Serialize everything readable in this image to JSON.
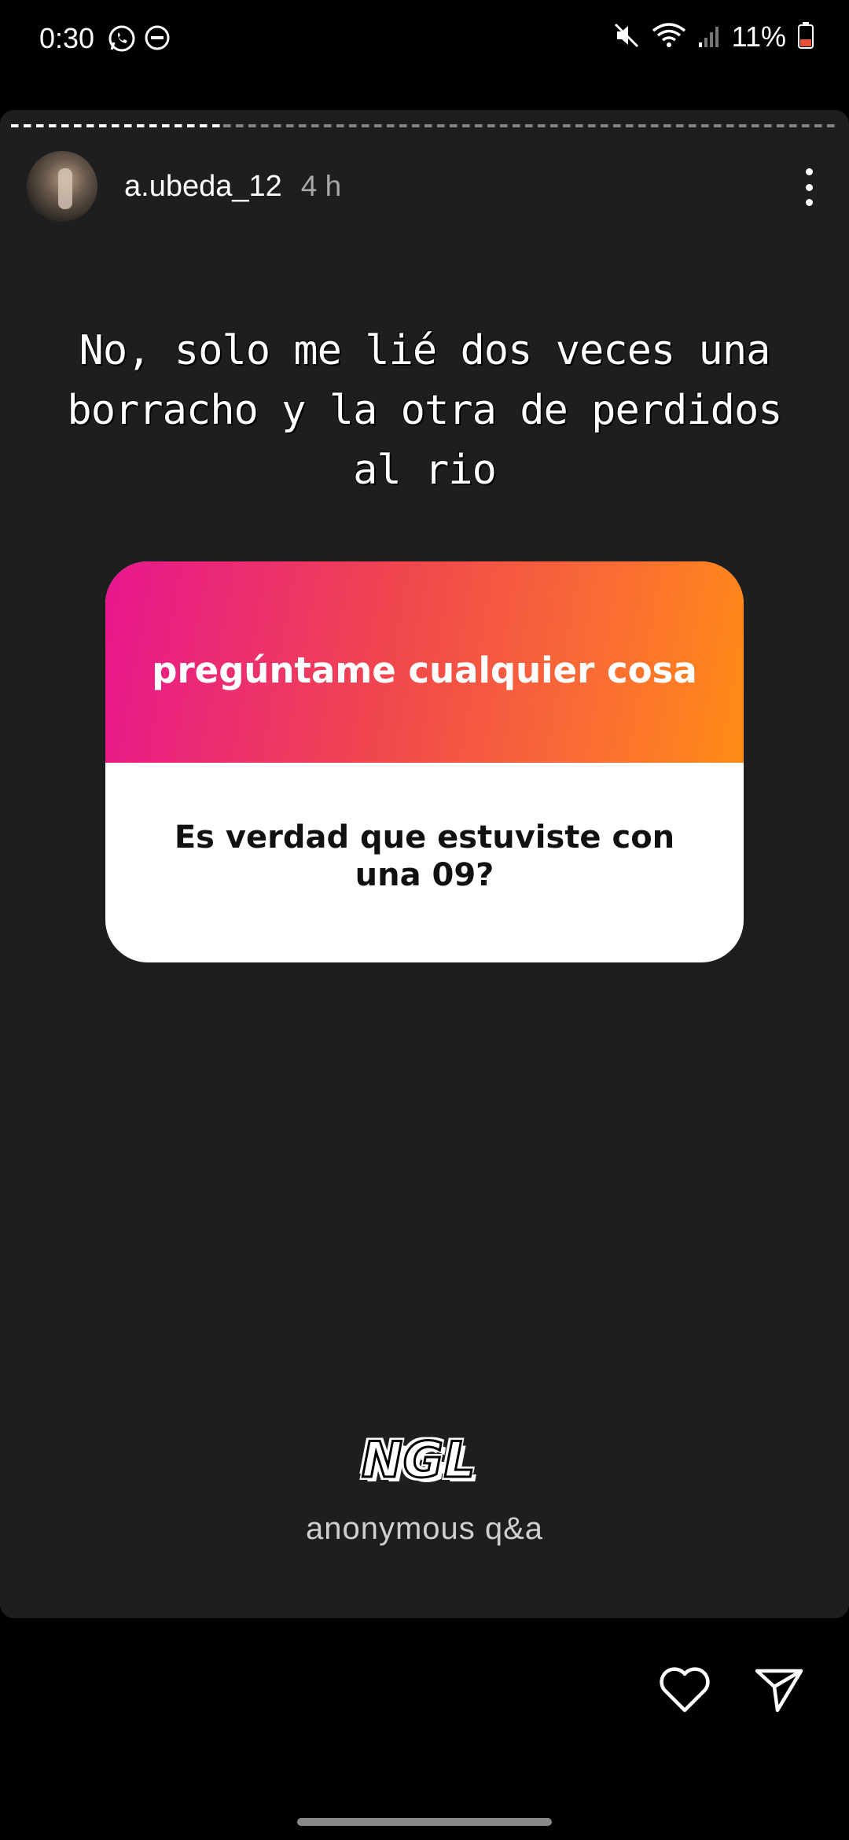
{
  "status_bar": {
    "time": "0:30",
    "battery": "11%",
    "icons": [
      "whatsapp-icon",
      "dnd-icon",
      "mute-icon",
      "wifi-icon",
      "signal-icon",
      "battery-icon"
    ]
  },
  "story": {
    "username": "a.ubeda_12",
    "time_ago": "4 h",
    "answer": "No, solo me lié dos veces una borracho y la otra de perdidos al rio",
    "question_card": {
      "header": "pregúntame cualquier cosa",
      "question": "Es verdad que estuviste con una 09?"
    },
    "brand": {
      "logo_text": "NGL",
      "caption": "anonymous q&a"
    }
  },
  "colors": {
    "story_bg": "#1e1e1e",
    "gradient_start": "#e8168f",
    "gradient_end": "#ff8c16",
    "battery_low": "#e5533d"
  }
}
